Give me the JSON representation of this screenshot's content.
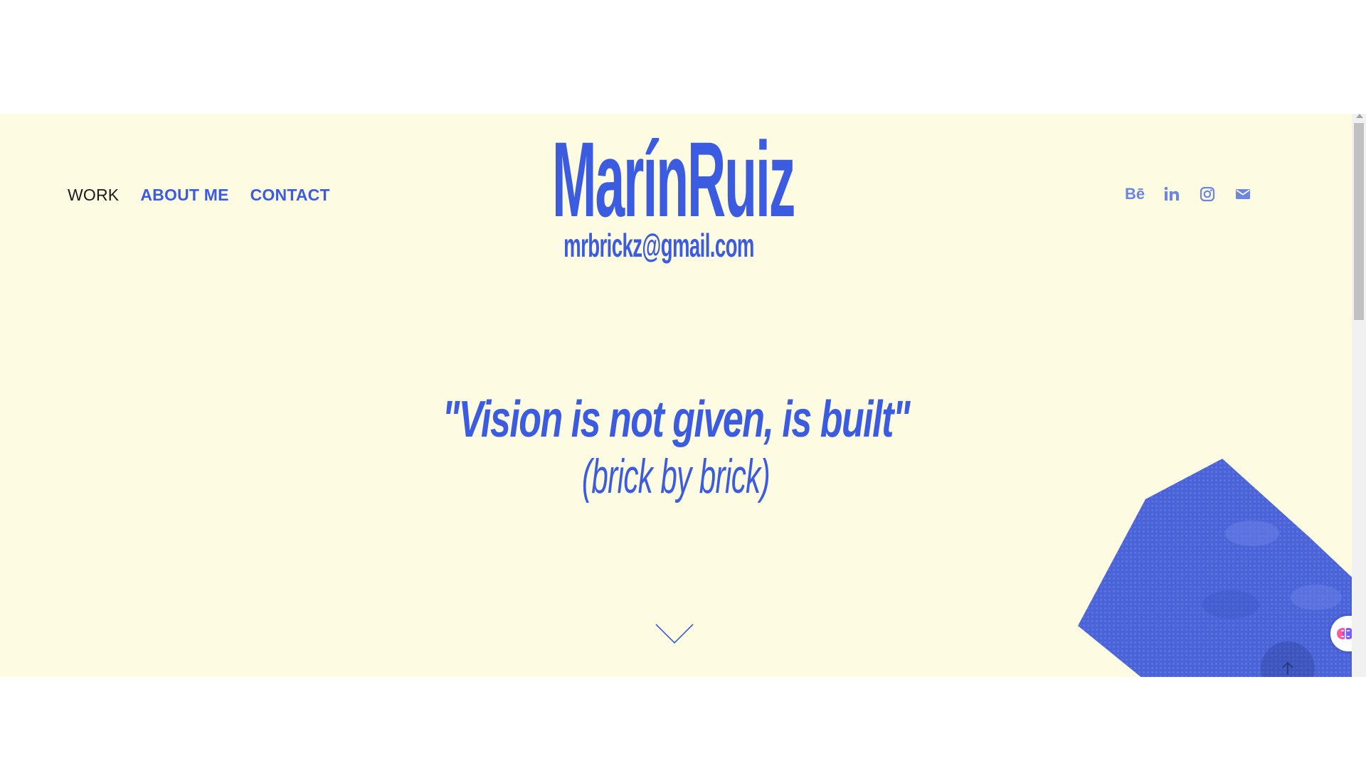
{
  "nav": {
    "work_label": "WORK",
    "about_label": "ABOUT ME",
    "contact_label": "CONTACT"
  },
  "logo": {
    "name": "MarínRuiz",
    "email": "mrbrickz@gmail.com"
  },
  "social": {
    "behance_label": "Bē",
    "icons": [
      "behance-icon",
      "linkedin-icon",
      "instagram-icon",
      "mail-icon"
    ]
  },
  "hero": {
    "quote": "\"Vision is not given, is built\"",
    "subquote": "(brick by brick)"
  },
  "colors": {
    "background": "#fefbe3",
    "accent": "#3b5ce0",
    "icon": "#6b86e3",
    "text_dark": "#1a1a1a"
  }
}
